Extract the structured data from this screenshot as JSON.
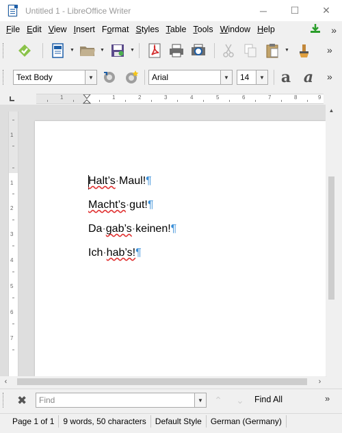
{
  "window": {
    "title": "Untitled 1 - LibreOffice Writer",
    "minimize_glyph": "─",
    "maximize_glyph": "☐",
    "close_glyph": "✕"
  },
  "menubar": {
    "items": [
      {
        "key": "F",
        "rest": "ile"
      },
      {
        "key": "E",
        "rest": "dit"
      },
      {
        "key": "V",
        "rest": "iew"
      },
      {
        "key": "I",
        "rest": "nsert"
      },
      {
        "key": "",
        "rest": "Format",
        "ul_index": 1
      },
      {
        "key": "S",
        "rest": "tyles"
      },
      {
        "key": "T",
        "rest": "able"
      },
      {
        "key": "T",
        "rest": "ools"
      },
      {
        "key": "W",
        "rest": "indow"
      },
      {
        "key": "H",
        "rest": "elp"
      }
    ],
    "labels": [
      "File",
      "Edit",
      "View",
      "Insert",
      "Format",
      "Styles",
      "Table",
      "Tools",
      "Window",
      "Help"
    ],
    "more_glyph": "»"
  },
  "toolbar1": {
    "icons": [
      "update-icon",
      "new-document-icon",
      "open-folder-icon",
      "save-icon",
      "export-pdf-icon",
      "print-icon",
      "print-preview-icon",
      "cut-icon",
      "copy-icon",
      "paste-icon",
      "clone-formatting-icon"
    ],
    "more_glyph": "»"
  },
  "toolbar2": {
    "paragraph_style": "Text Body",
    "font_name": "Arial",
    "font_size": "14",
    "more_glyph": "»"
  },
  "ruler": {
    "h_labels": [
      "1",
      "1",
      "2",
      "3",
      "4",
      "5",
      "6",
      "7",
      "8",
      "9"
    ],
    "v_labels": [
      "1",
      "1",
      "2",
      "3",
      "4",
      "5",
      "6",
      "7"
    ]
  },
  "document": {
    "paragraphs": [
      {
        "words": [
          {
            "t": "Halt’s",
            "sq": true
          },
          {
            "t": "Maul!",
            "sq": false
          }
        ]
      },
      {
        "words": [
          {
            "t": "Macht’s",
            "sq": true
          },
          {
            "t": "gut!",
            "sq": false
          }
        ]
      },
      {
        "words": [
          {
            "t": "Da",
            "sq": false
          },
          {
            "t": "gab’s",
            "sq": true
          },
          {
            "t": "keinen!",
            "sq": false
          }
        ]
      },
      {
        "words": [
          {
            "t": "Ich",
            "sq": false
          },
          {
            "t": "hab’s!",
            "sq": true
          }
        ]
      }
    ],
    "space_mark": "·",
    "pilcrow": "¶"
  },
  "findbar": {
    "placeholder": "Find",
    "find_all_label": "Find All",
    "close_glyph": "✖",
    "up_glyph": "⌃",
    "down_glyph": "⌄",
    "more_glyph": "»"
  },
  "statusbar": {
    "page": "Page 1 of 1",
    "words": "9 words, 50 characters",
    "page_style": "Default Style",
    "language": "German (Germany)"
  },
  "colors": {
    "accent": "#1c5ea7",
    "pilcrow": "#3a8fd8",
    "spellcheck": "#e03030"
  }
}
